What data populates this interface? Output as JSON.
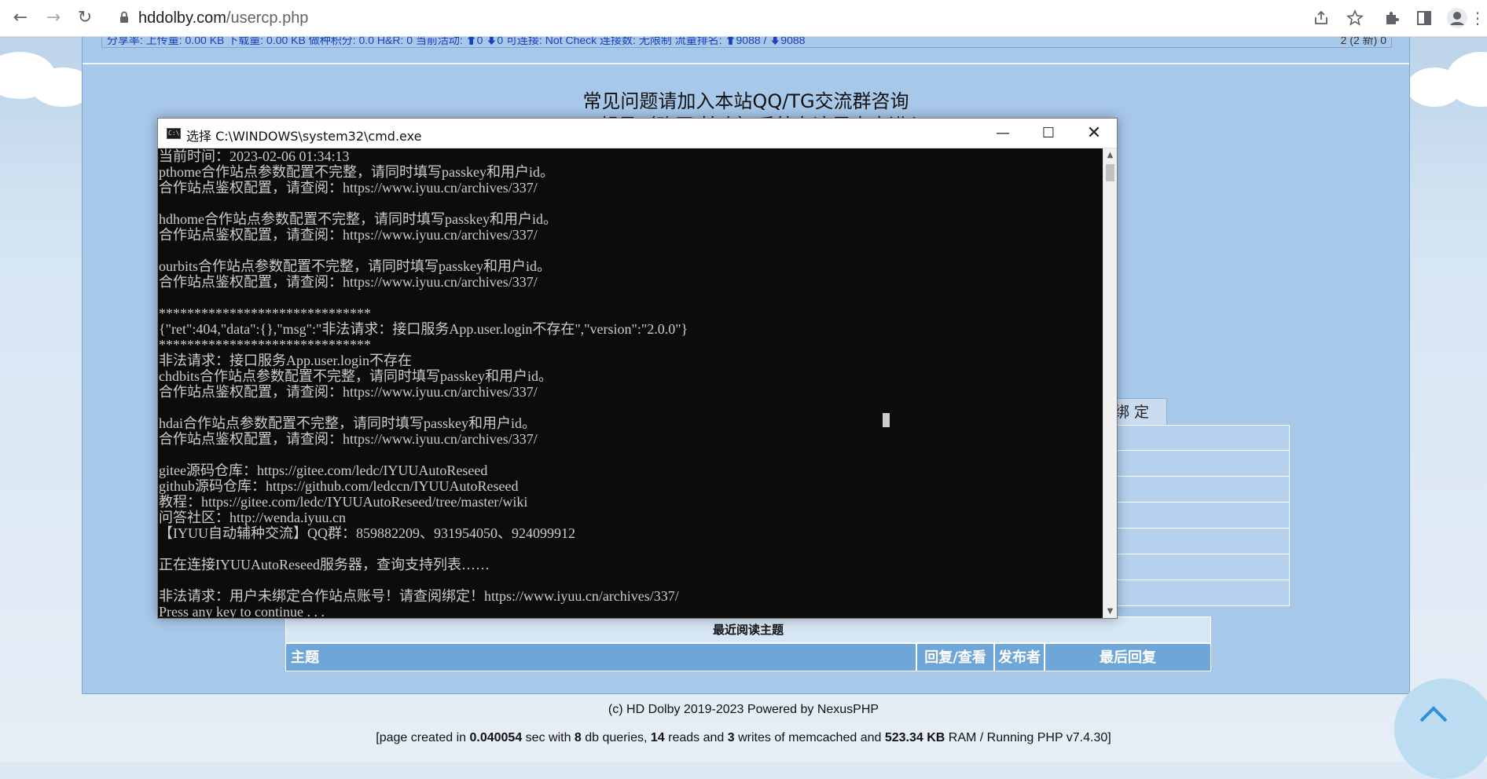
{
  "browser": {
    "url_host": "hddolby.com",
    "url_path": "/usercp.php"
  },
  "page": {
    "stat_bar_text": "分享率:    上传量:  0.00 KB 下载量:  0.00 KB 做种积分: 0.0 H&R: 0 当前活动: ⬆0 ⬇0 可连接: Not Check 连接数: 无限制 流量排名: ⬆9088 / ⬇9088",
    "stat_bar_right": "2 (2 新)  0",
    "notice_title": "常见问题请加入本站QQ/TG交流群咨询",
    "notice_sub": "UID靓号（购买/拍卖）系统在这里点击进入",
    "bind_tab": "绑 定",
    "recent_header": "最近阅读主题",
    "columns": {
      "topic": "主题",
      "replies_views": "回复/查看",
      "author": "发布者",
      "last_reply": "最后回复"
    },
    "footer_copy": "(c) HD Dolby 2019-2023 Powered by NexusPHP",
    "footer_stats": {
      "pre": "[page created in ",
      "time": "0.040054",
      "mid1": " sec with ",
      "queries": "8",
      "mid2": " db queries, ",
      "reads": "14",
      "mid3": " reads and ",
      "writes": "3",
      "mid4": " writes of memcached and ",
      "ram": "523.34 KB",
      "post": " RAM / Running PHP v7.4.30]"
    }
  },
  "cmd": {
    "title": "选择 C:\\WINDOWS\\system32\\cmd.exe",
    "lines": [
      "当前时间：2023-02-06 01:34:13",
      "pthome合作站点参数配置不完整，请同时填写passkey和用户id。",
      "合作站点鉴权配置，请查阅：https://www.iyuu.cn/archives/337/",
      "",
      "hdhome合作站点参数配置不完整，请同时填写passkey和用户id。",
      "合作站点鉴权配置，请查阅：https://www.iyuu.cn/archives/337/",
      "",
      "ourbits合作站点参数配置不完整，请同时填写passkey和用户id。",
      "合作站点鉴权配置，请查阅：https://www.iyuu.cn/archives/337/",
      "",
      "******************************",
      "{\"ret\":404,\"data\":{},\"msg\":\"非法请求：接口服务App.user.login不存在\",\"version\":\"2.0.0\"}",
      "******************************",
      "非法请求：接口服务App.user.login不存在",
      "chdbits合作站点参数配置不完整，请同时填写passkey和用户id。",
      "合作站点鉴权配置，请查阅：https://www.iyuu.cn/archives/337/",
      "",
      "hdai合作站点参数配置不完整，请同时填写passkey和用户id。",
      "合作站点鉴权配置，请查阅：https://www.iyuu.cn/archives/337/",
      "",
      "gitee源码仓库：https://gitee.com/ledc/IYUUAutoReseed",
      "github源码仓库：https://github.com/ledccn/IYUUAutoReseed",
      "教程：https://gitee.com/ledc/IYUUAutoReseed/tree/master/wiki",
      "问答社区：http://wenda.iyuu.cn",
      "【IYUU自动辅种交流】QQ群：859882209、931954050、924099912",
      "",
      "正在连接IYUUAutoReseed服务器，查询支持列表……",
      "",
      "非法请求：用户未绑定合作站点账号！请查阅绑定！https://www.iyuu.cn/archives/337/",
      "Press any key to continue . . ."
    ]
  }
}
